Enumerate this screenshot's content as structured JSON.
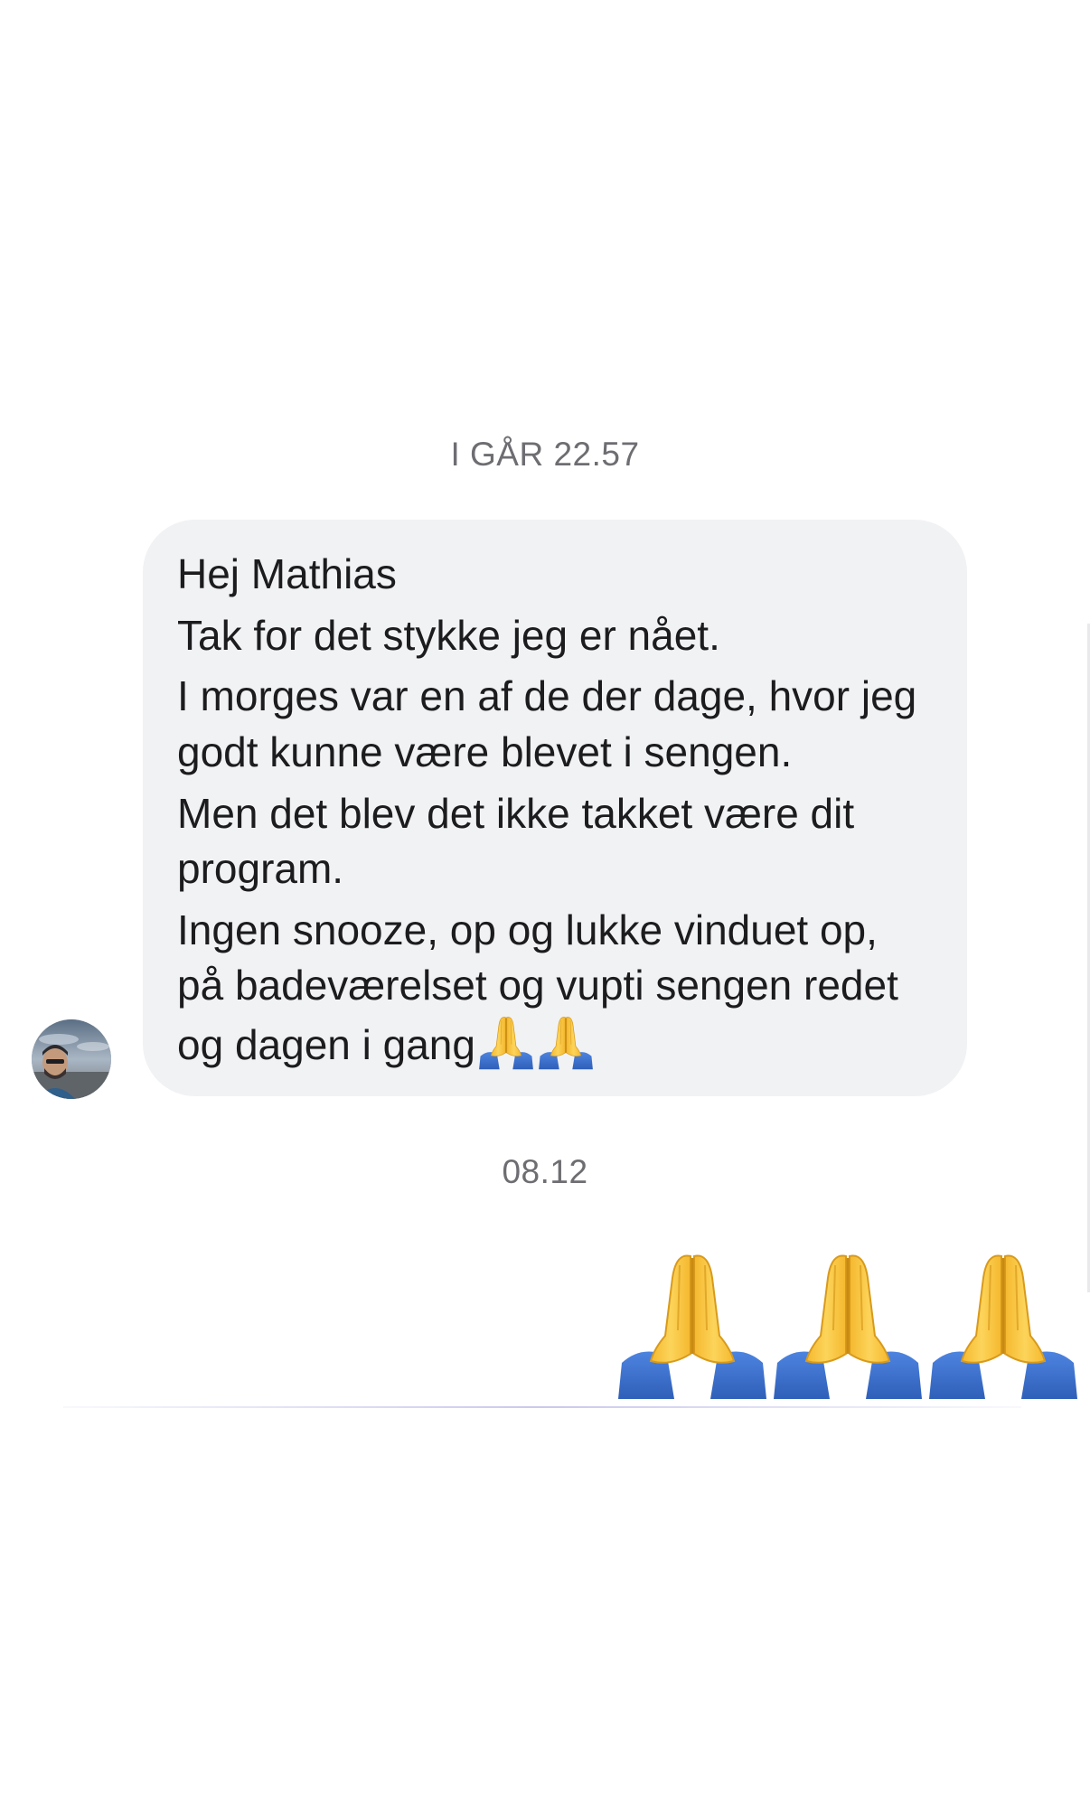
{
  "conversation": {
    "timestamp_1": "I GÅR 22.57",
    "incoming_message": {
      "lines": [
        "Hej Mathias",
        "Tak for det stykke jeg er nået.",
        "I morges var en af de der dage, hvor jeg godt kunne være blevet i sengen.",
        "Men det blev det ikke takket være dit program.",
        "Ingen snooze, op og lukke vinduet op, på badeværelset og vupti sengen redet og dagen i gang"
      ],
      "trailing_emoji": "praying-hands x2"
    },
    "timestamp_2": "08.12",
    "outgoing_message": {
      "emoji": "praying-hands x3"
    }
  },
  "colors": {
    "bubble_background": "#f1f2f4",
    "timestamp_text": "#6d6d72",
    "message_text": "#1c1c1e",
    "emoji_yellow": "#f7c23a",
    "emoji_sleeve": "#3d6fcf"
  }
}
